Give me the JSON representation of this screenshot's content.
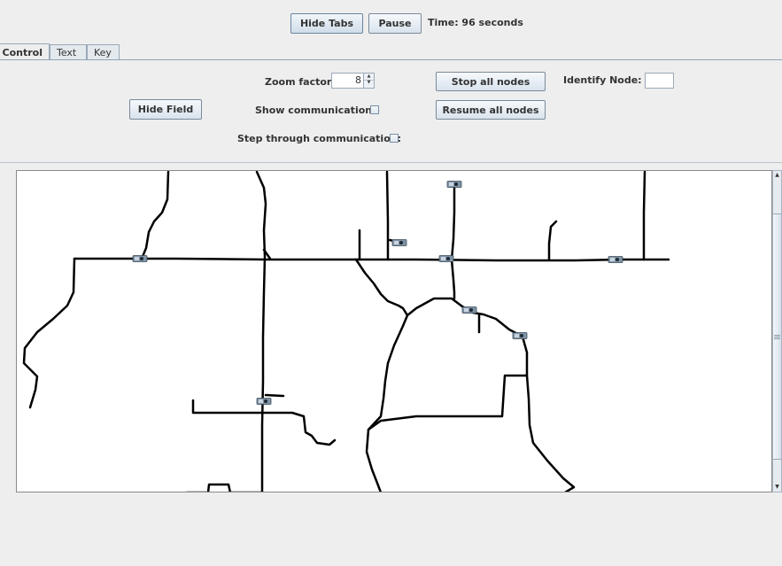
{
  "toolbar": {
    "hide_tabs_label": "Hide Tabs",
    "pause_label": "Pause",
    "time_text": "Time: 96 seconds"
  },
  "tabs": [
    {
      "label": "Control",
      "active": true
    },
    {
      "label": "Text",
      "active": false
    },
    {
      "label": "Key",
      "active": false
    }
  ],
  "control": {
    "zoom_label": "Zoom factor:",
    "zoom_value": "8",
    "stop_all_label": "Stop all nodes",
    "identify_label": "Identify Node:",
    "identify_value": "",
    "hide_field_label": "Hide Field",
    "show_comm_label": "Show communication:",
    "show_comm_checked": false,
    "resume_all_label": "Resume all nodes",
    "step_comm_label": "Step through communication:",
    "step_comm_checked": false
  },
  "icons": {
    "node": "sensor-node-icon",
    "spinner_up": "spinner-up-icon",
    "spinner_down": "spinner-down-icon",
    "scroll_up": "scroll-up-icon",
    "scroll_down": "scroll-down-icon"
  },
  "colors": {
    "background": "#eeeeee",
    "field_background": "#ffffff",
    "road": "#000000"
  }
}
